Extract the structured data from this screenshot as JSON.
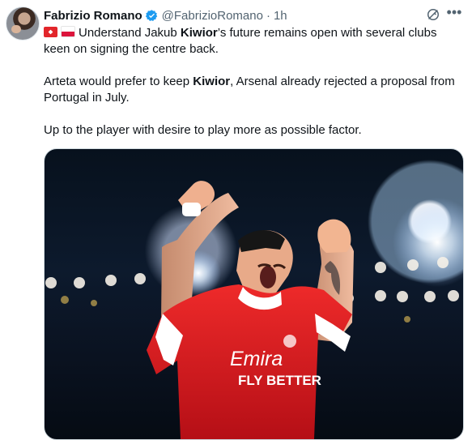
{
  "author": {
    "name": "Fabrizio Romano",
    "handle": "@FabrizioRomano",
    "separator": "·",
    "time": "1h",
    "avatar_icon": "profile-avatar"
  },
  "tweet": {
    "line1_after_flags": "Understand Jakub ",
    "line1_bold": "Kiwior",
    "line1_rest": "’s future remains open with several clubs keen on signing the centre back.",
    "line2_before": "Arteta would prefer to keep ",
    "line2_bold": "Kiwior",
    "line2_rest": ", Arsenal already rejected a proposal from Portugal in July.",
    "line3": "Up to the player with desire to play more as possible factor."
  },
  "media": {
    "shirt_sponsor_top": "Emira",
    "shirt_sponsor_bottom": "FLY BETTER",
    "accent_red": "#d71920",
    "accent_white": "#ffffff"
  },
  "icons": [
    "verified-badge-icon",
    "grok-icon",
    "more-options-icon",
    "arsenal-flag-icon",
    "poland-flag-icon"
  ]
}
